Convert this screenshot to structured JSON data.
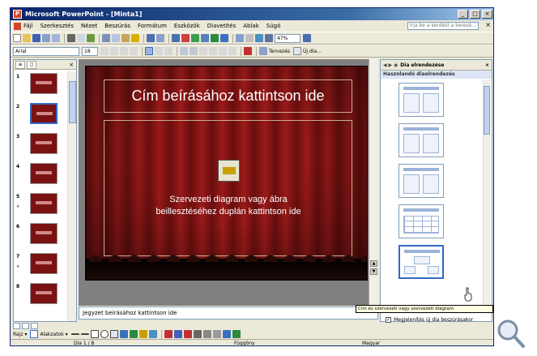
{
  "window": {
    "title": "Microsoft PowerPoint - [Minta1]",
    "app_icon": "P",
    "controls": [
      "_",
      "□",
      "×"
    ]
  },
  "menu": {
    "items": [
      "Fájl",
      "Szerkesztés",
      "Nézet",
      "Beszúrás",
      "Formátum",
      "Eszközök",
      "Diavetítés",
      "Ablak",
      "Súgó"
    ],
    "ask_placeholder": "Írja be a kérdést a keresé...",
    "close": "× "
  },
  "toolbar": {
    "zoom": "47%",
    "font_name": "Arial",
    "font_size": "18",
    "design_label": "Tervezés",
    "new_slide_label": "Új dia..."
  },
  "left_pane": {
    "tabs": [
      "≡",
      "◻"
    ],
    "close": "×",
    "slides": [
      {
        "num": "1",
        "star": ""
      },
      {
        "num": "2",
        "star": ""
      },
      {
        "num": "3",
        "star": ""
      },
      {
        "num": "4",
        "star": ""
      },
      {
        "num": "5",
        "star": "★"
      },
      {
        "num": "6",
        "star": ""
      },
      {
        "num": "7",
        "star": "★"
      },
      {
        "num": "8",
        "star": ""
      }
    ]
  },
  "slide": {
    "title_placeholder": "Cím beírásához kattintson ide",
    "body_line1": "Szervezeti diagram vagy ábra",
    "body_line2": "beillesztéséhez duplán kattintson ide"
  },
  "notes": {
    "placeholder": "Jegyzet beírásához kattintson ide"
  },
  "task_pane": {
    "title": "Dia elrendezése",
    "nav": "◀ ▶ ◉",
    "close": "×",
    "section": "Hasznlandó diaelrendezés",
    "tooltip": "Cím és szervezeti vagy szervezeti diagram",
    "checkbox_label": "Megjelenítés új dia beszúrásakor"
  },
  "drawbar": {
    "draw_label": "Rajz ▾",
    "autoshapes_label": "Alakzatok ▾"
  },
  "status": {
    "slide_info": "Dia 1 / 8",
    "design": "Függöny",
    "language": "Magyar"
  },
  "icons": [
    "search-icon",
    "gear-icon"
  ],
  "colors": {
    "titlebar": "#0a246a",
    "slide_red": "#9a1a1a",
    "selection": "#316ac5"
  }
}
